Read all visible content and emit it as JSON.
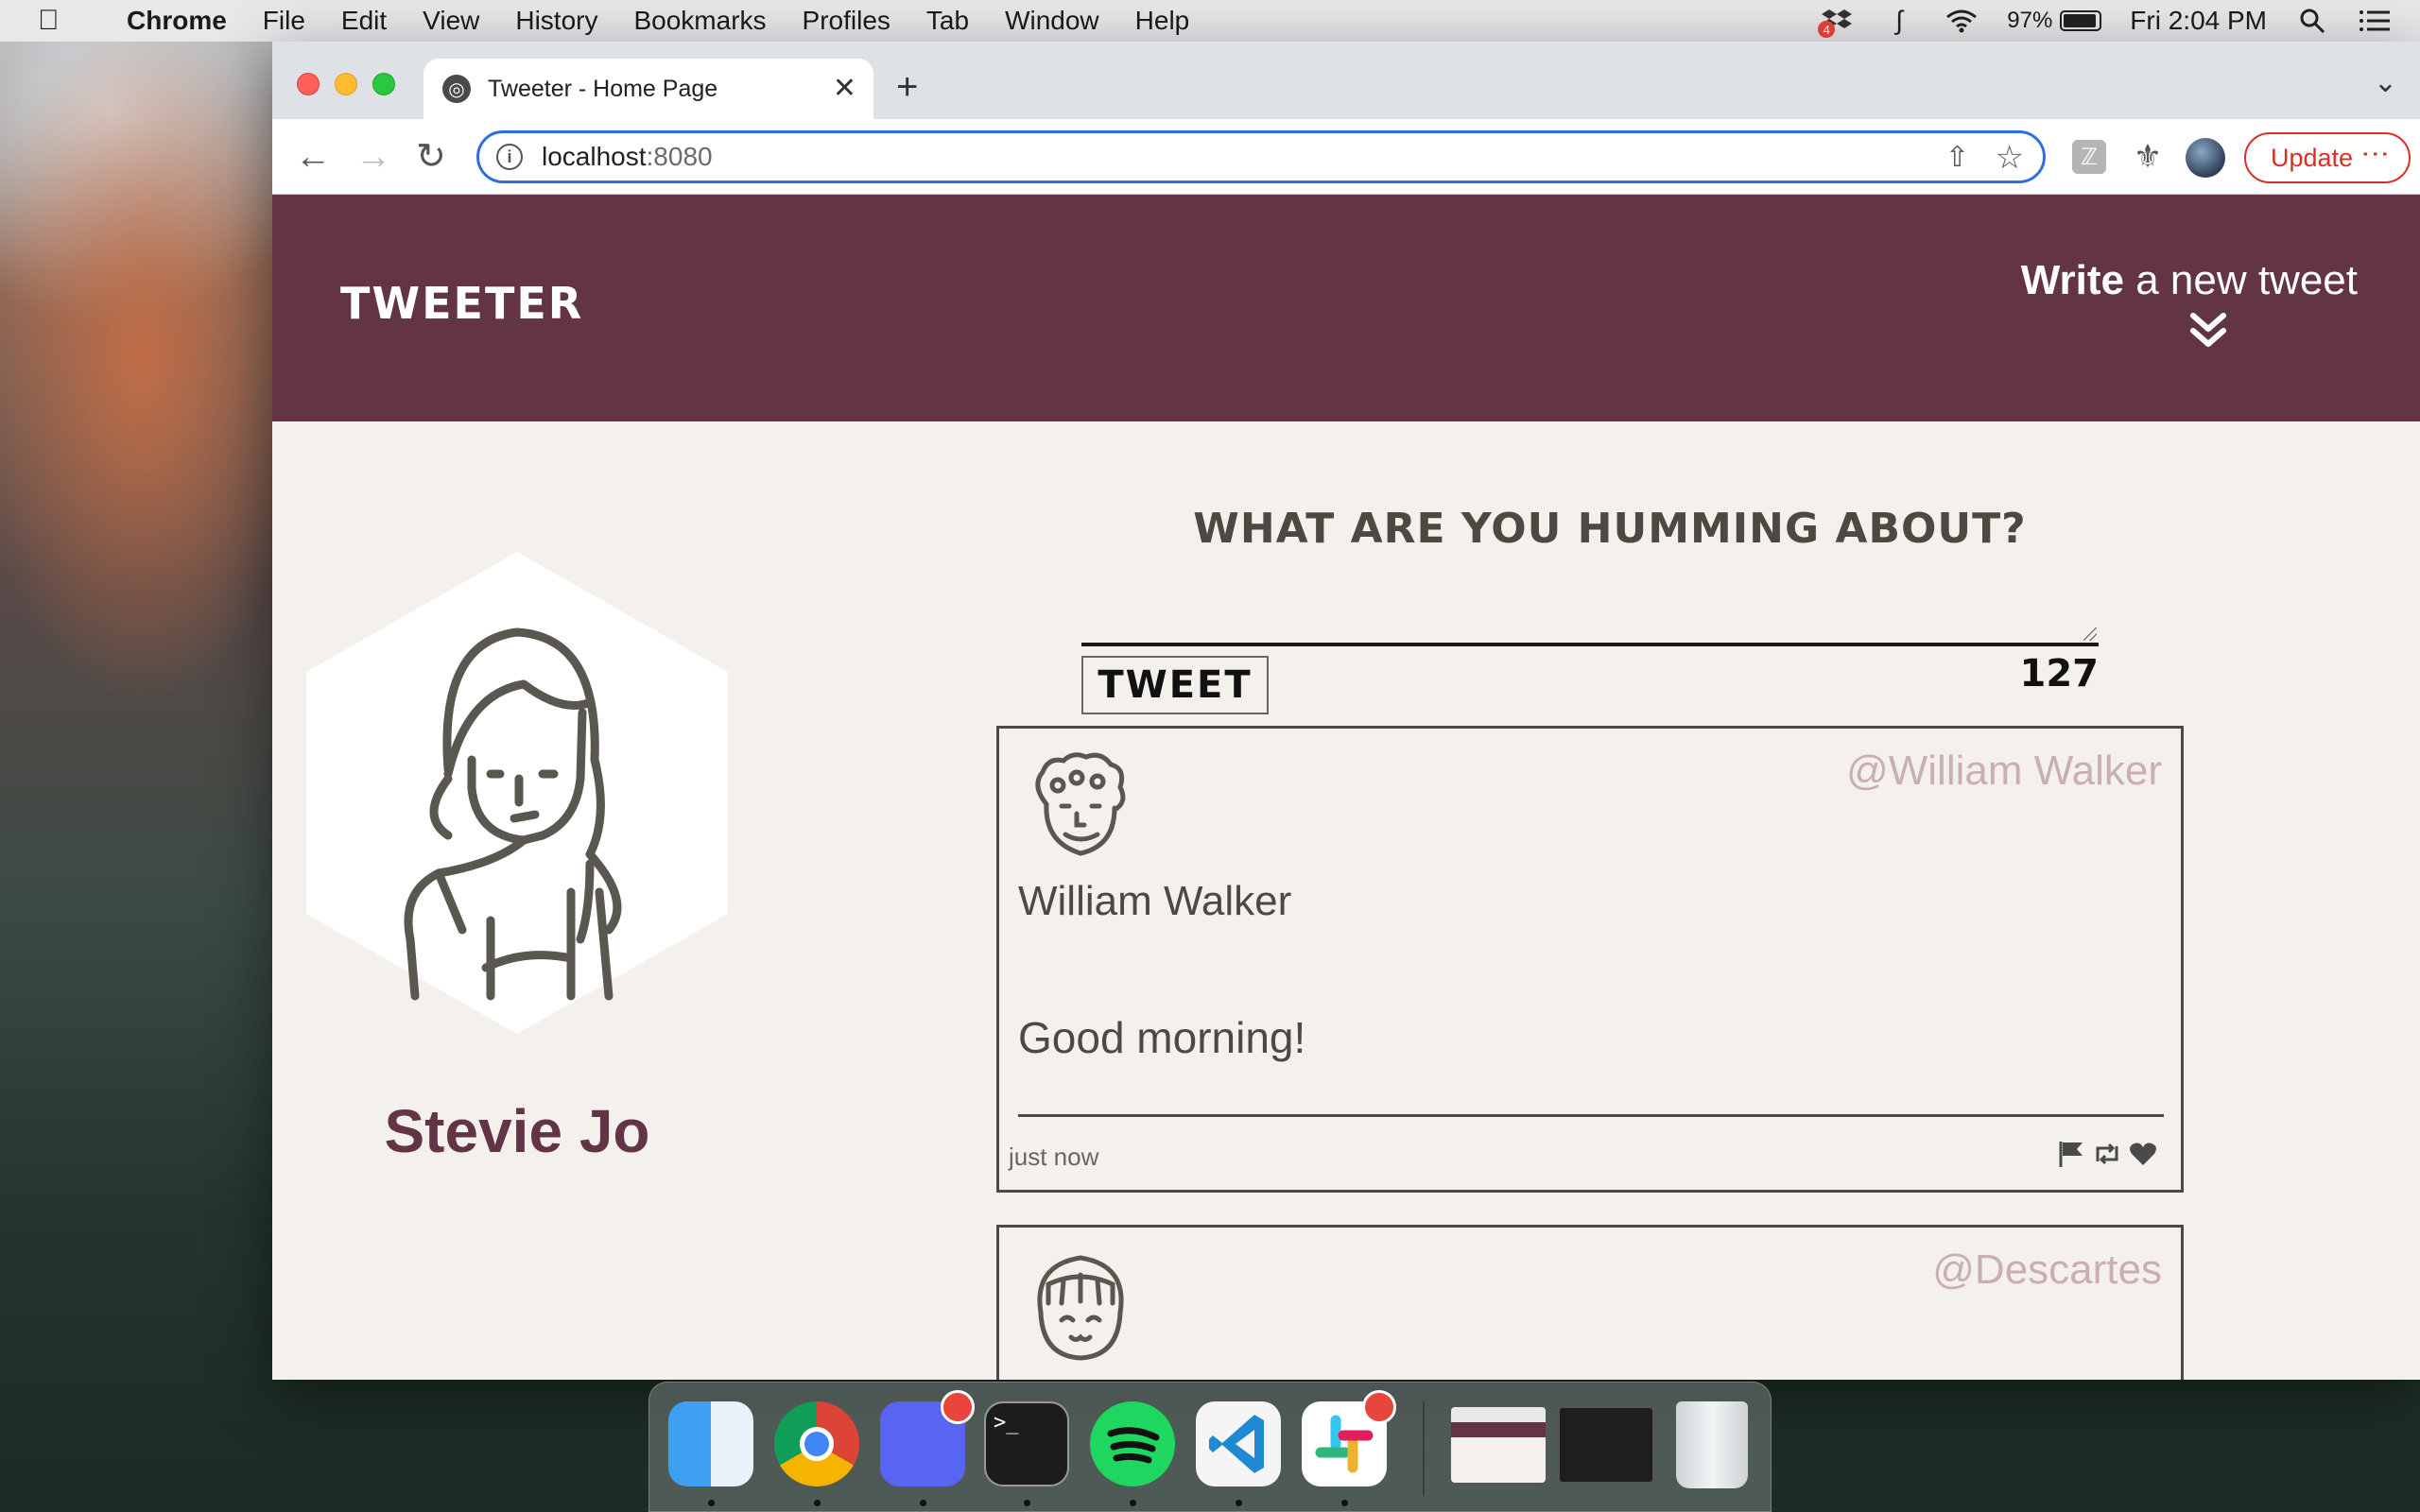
{
  "menubar": {
    "app": "Chrome",
    "items": [
      "File",
      "Edit",
      "View",
      "History",
      "Bookmarks",
      "Profiles",
      "Tab",
      "Window",
      "Help"
    ],
    "battery": "97%",
    "clock": "Fri 2:04 PM",
    "dropbox_badge": "4"
  },
  "browser": {
    "tab_title": "Tweeter - Home Page",
    "url_host": "localhost",
    "url_port": ":8080",
    "update_label": "Update"
  },
  "page": {
    "brand": "TWEETER",
    "write_bold": "Write",
    "write_rest": " a new tweet",
    "profile_name": "Stevie Jo",
    "compose_heading": "WHAT ARE YOU HUMMING ABOUT?",
    "tweet_button": "TWEET",
    "char_counter": "127",
    "tweets": [
      {
        "handle": "@William Walker",
        "name": "William Walker",
        "text": "Good morning!",
        "time": "just now"
      },
      {
        "handle": "@Descartes"
      }
    ]
  },
  "colors": {
    "navbar": "#623445",
    "page_bg": "#f4f1ec",
    "handle": "#c9aeb8",
    "update": "#d93025"
  }
}
